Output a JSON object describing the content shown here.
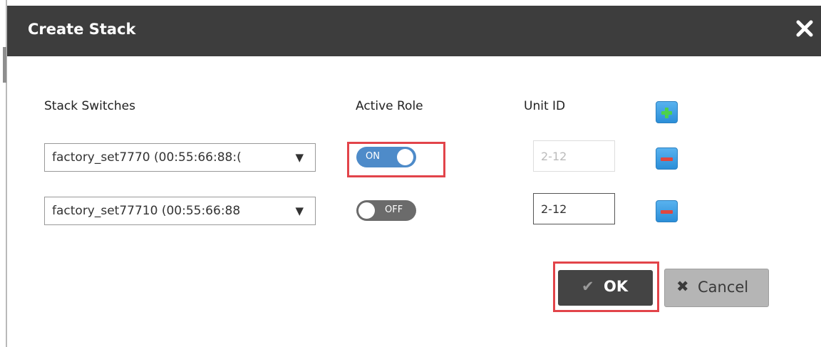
{
  "dialog": {
    "title": "Create Stack",
    "close_icon": "close-icon"
  },
  "table": {
    "headers": {
      "stack_switches": "Stack Switches",
      "active_role": "Active Role",
      "unit_id": "Unit ID"
    },
    "add_icon": "plus-icon",
    "remove_icon": "minus-icon",
    "rows": [
      {
        "switch": "factory_set7770 (00:55:66:88:(",
        "active_role": "ON",
        "active_role_state": "on",
        "unit_id_placeholder": "2-12",
        "unit_id_enabled": false
      },
      {
        "switch": "factory_set77710 (00:55:66:88",
        "active_role": "OFF",
        "active_role_state": "off",
        "unit_id_placeholder": "2-12",
        "unit_id_enabled": true
      }
    ]
  },
  "footer": {
    "ok_label": "OK",
    "ok_icon": "check-icon",
    "cancel_label": "Cancel",
    "cancel_icon": "x-icon"
  },
  "colors": {
    "header_bg": "#3d3d3d",
    "toggle_on": "#4e8bc9",
    "toggle_off": "#6b6b6b",
    "icon_button": "#2b8ed8",
    "highlight": "#e2444a"
  }
}
